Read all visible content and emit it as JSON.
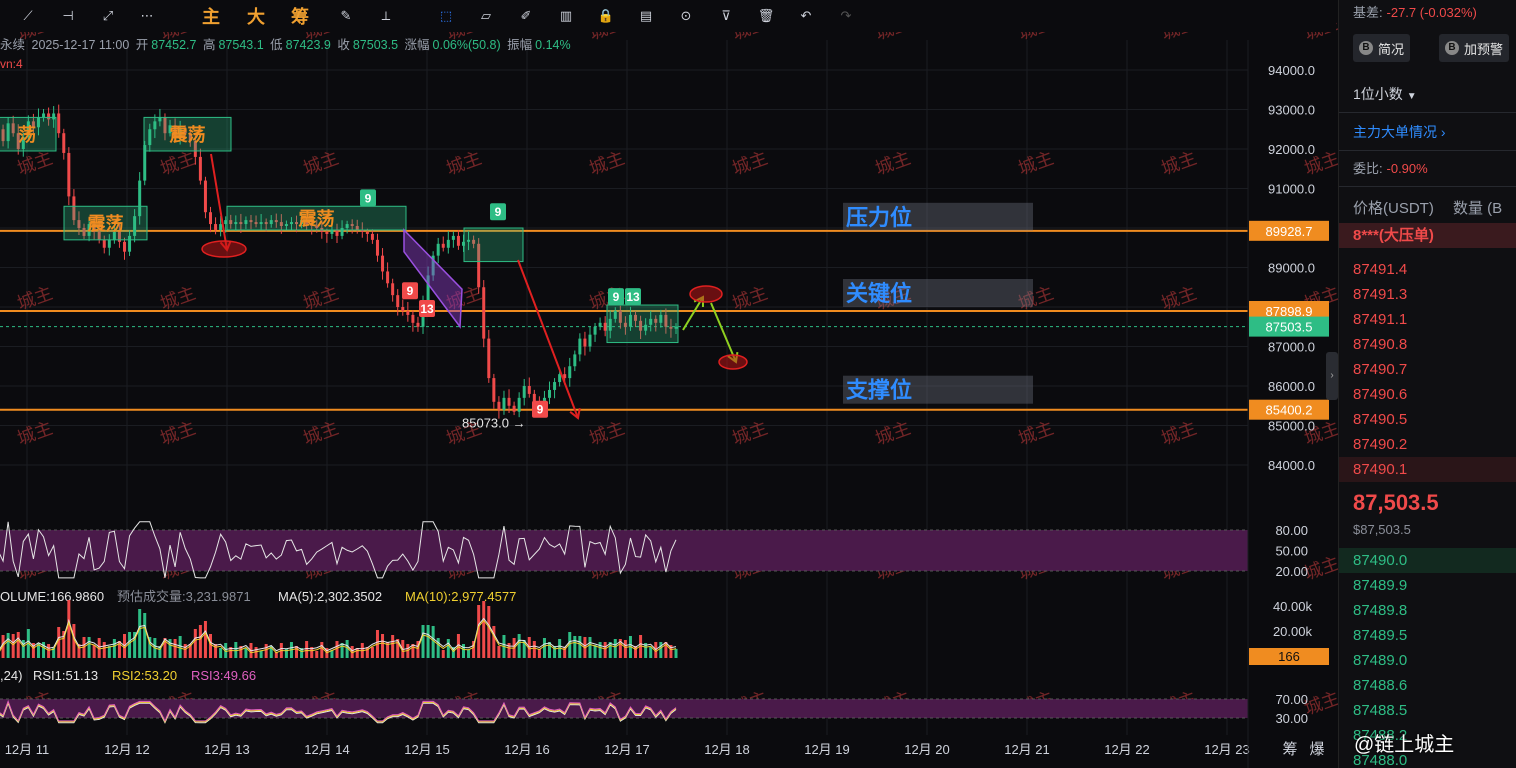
{
  "toolbar": {
    "text_buttons": [
      "主",
      "大",
      "筹"
    ],
    "icons": [
      "line-tool-icon",
      "horizontal-line-icon",
      "trend-line-icon",
      "more-icon",
      "edit-icon",
      "measure-icon",
      "cursor-icon",
      "ruler-icon",
      "pencil-icon",
      "candle-icon",
      "lock-icon",
      "note-icon",
      "magnet-icon",
      "filter-icon",
      "trash-icon",
      "undo-icon",
      "redo-icon"
    ]
  },
  "info": {
    "symbol": "永续",
    "datetime": "2025-12-17 11:00",
    "open_label": "开",
    "open": "87452.7",
    "high_label": "高",
    "high": "87543.1",
    "low_label": "低",
    "low": "87423.9",
    "close_label": "收",
    "close": "87503.5",
    "change_label": "涨幅",
    "change": "0.06%(50.8)",
    "amp_label": "振幅",
    "amp": "0.14%",
    "vn": "vn:4"
  },
  "volume_info": {
    "volume": "OLUME:166.9860",
    "est_label": "预估成交量:3,231.9871",
    "ma5": "MA(5):2,302.3502",
    "ma10": "MA(10):2,977.4577"
  },
  "rsi_info": {
    "prefix": ",24)",
    "rsi1": "RSI1:51.13",
    "rsi2": "RSI2:53.20",
    "rsi3": "RSI3:49.66"
  },
  "right_panel": {
    "basis_label": "基差:",
    "basis_value": "-27.7 (-0.032%)",
    "btn_profile": "简况",
    "btn_alert": "加预警",
    "decimals": "1位小数",
    "big_orders": "主力大单情况",
    "ratio_label": "委比:",
    "ratio_value": "-0.90%",
    "col_price": "价格(USDT)",
    "col_qty": "数量 (B",
    "big_ask": "8***(大压单)",
    "asks": [
      "87491.4",
      "87491.3",
      "87491.1",
      "87490.8",
      "87490.7",
      "87490.6",
      "87490.5",
      "87490.2",
      "87490.1"
    ],
    "last_price": "87,503.5",
    "last_price_usd": "$87,503.5",
    "bids": [
      "87490.0",
      "87489.9",
      "87489.8",
      "87489.5",
      "87489.0",
      "87488.6",
      "87488.5",
      "87488.2",
      "87488.0"
    ]
  },
  "brand": "@链上城主",
  "watermark": "城主",
  "colors": {
    "up": "#2ebd85",
    "down": "#f04a4a",
    "level_line": "#f08c20",
    "label_blue": "#2f8cff",
    "zone_box": "#2ebd85",
    "annotation_red": "#e02020",
    "annotation_green": "#8fd020",
    "rsi_band": "#4a1a4a"
  },
  "chart_data": {
    "type": "candlestick",
    "y_ticks": [
      "94000.0",
      "93000.0",
      "92000.0",
      "91000.0",
      "89000.0",
      "88000.0",
      "87000.0",
      "86000.0",
      "85000.0",
      "84000.0"
    ],
    "ylim": [
      83400,
      94600
    ],
    "x_ticks": [
      "12月 11",
      "12月 12",
      "12月 13",
      "12月 14",
      "12月 15",
      "12月 16",
      "12月 17",
      "12月 18",
      "12月 19",
      "12月 20",
      "12月 21",
      "12月 22",
      "12月 23"
    ],
    "x_tail_labels": [
      "筹",
      "爆"
    ],
    "levels": [
      {
        "name": "压力位",
        "value": 89928.7,
        "label": "89928.7"
      },
      {
        "name": "关键位",
        "value": 87898.9,
        "label": "87898.9"
      },
      {
        "name": "支撑位",
        "value": 85400.2,
        "label": "85400.2"
      }
    ],
    "current_price": {
      "value": 87503.5,
      "label": "87503.5"
    },
    "low_marker": {
      "value": 85073.0,
      "label": "85073.0"
    },
    "zone_labels": [
      "荡",
      "震荡",
      "震荡",
      "震荡"
    ],
    "td_counts": [
      "9",
      "9",
      "13",
      "9",
      "9",
      "13",
      "9"
    ],
    "approx_closes": [
      92500,
      92200,
      92650,
      92400,
      92000,
      92300,
      92700,
      92550,
      92800,
      92900,
      92750,
      92900,
      92400,
      91900,
      90800,
      90200,
      90000,
      89800,
      90100,
      89900,
      89700,
      89500,
      89700,
      89900,
      89650,
      89400,
      89800,
      90300,
      91200,
      92100,
      92500,
      92700,
      92800,
      92400,
      92600,
      92300,
      92500,
      92400,
      92200,
      91800,
      91200,
      90400,
      90100,
      89950,
      90100,
      90200,
      90100,
      90150,
      90100,
      90200,
      90150,
      90100,
      90150,
      90100,
      90200,
      90150,
      90050,
      90100,
      90150,
      90100,
      90200,
      90100,
      90050,
      90000,
      89900,
      89850,
      89950,
      89800,
      90000,
      90100,
      90050,
      89950,
      89900,
      89850,
      89700,
      89300,
      88900,
      88600,
      88300,
      88000,
      87900,
      87800,
      87600,
      87500,
      88100,
      88800,
      89300,
      89600,
      89500,
      89700,
      89800,
      89550,
      89650,
      89700,
      89600,
      88500,
      87200,
      86200,
      85600,
      85400,
      85700,
      85500,
      85350,
      85700,
      86000,
      85800,
      85600,
      85500,
      85700,
      85900,
      86100,
      86300,
      86200,
      86500,
      86800,
      87200,
      87000,
      87300,
      87500,
      87600,
      87400,
      87700,
      87900,
      87600,
      87500,
      87800,
      87650,
      87400,
      87550,
      87700,
      87600,
      87800,
      87500,
      87450,
      87503
    ],
    "rsi_ticks": [
      "80.00",
      "50.00",
      "20.00"
    ],
    "volume_ticks": [
      "40.00k",
      "20.00k"
    ],
    "volume_current": "166",
    "rsi2_ticks": [
      "70.00",
      "30.00"
    ]
  }
}
